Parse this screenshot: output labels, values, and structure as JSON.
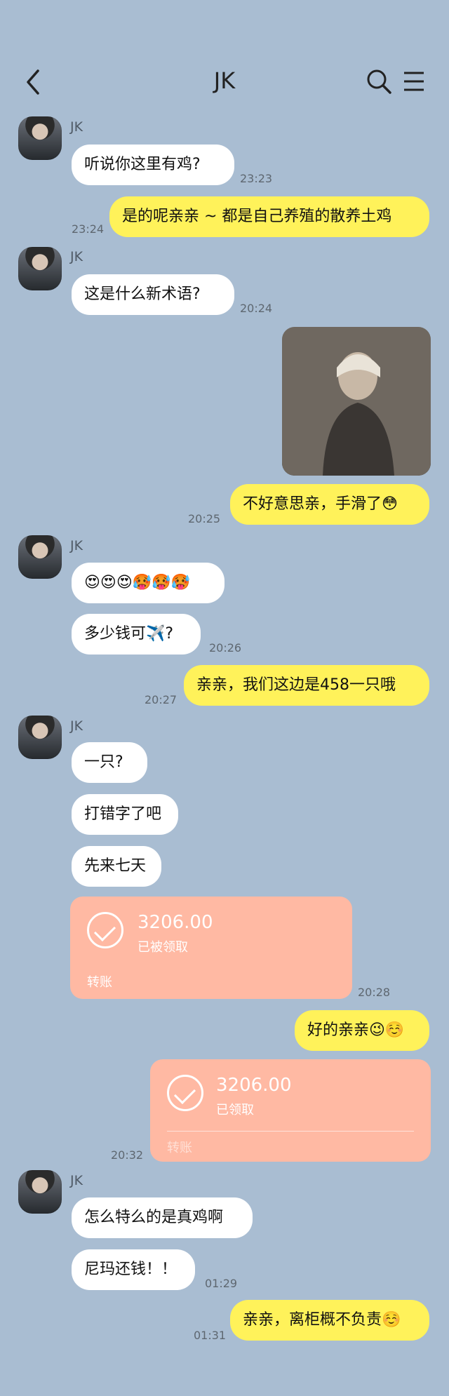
{
  "header": {
    "title": "JK"
  },
  "messages": [
    {
      "sender": "JK",
      "text": "听说你这里有鸡?",
      "time": "23:23"
    },
    {
      "text": "是的呢亲亲 ~ 都是自己养殖的散养土鸡",
      "time": "23:24"
    },
    {
      "sender": "JK",
      "text": "这是什么新术语?",
      "time": "20:24"
    },
    {
      "text": "不好意思亲，手滑了😳",
      "time": "20:25"
    },
    {
      "sender": "JK",
      "text": "😍😍😍🥵🥵🥵"
    },
    {
      "text": "多少钱可✈️?",
      "time": "20:26"
    },
    {
      "text": "亲亲，我们这边是458一只哦",
      "time": "20:27"
    },
    {
      "sender": "JK",
      "text": "一只?"
    },
    {
      "text": "打错字了吧"
    },
    {
      "text": "先来七天"
    },
    {
      "text": "好的亲亲😉☺️"
    },
    {
      "sender": "JK",
      "text": "怎么特么的是真鸡啊"
    },
    {
      "text": "尼玛还钱！！",
      "time": "01:29"
    },
    {
      "text": "亲亲，离柜概不负责☺️",
      "time": "01:31"
    }
  ],
  "transfers": [
    {
      "amount": "3206.00",
      "status": "已被领取",
      "footer": "转账",
      "time": "20:28"
    },
    {
      "amount": "3206.00",
      "status": "已领取",
      "footer": "转账",
      "time": "20:32"
    }
  ]
}
